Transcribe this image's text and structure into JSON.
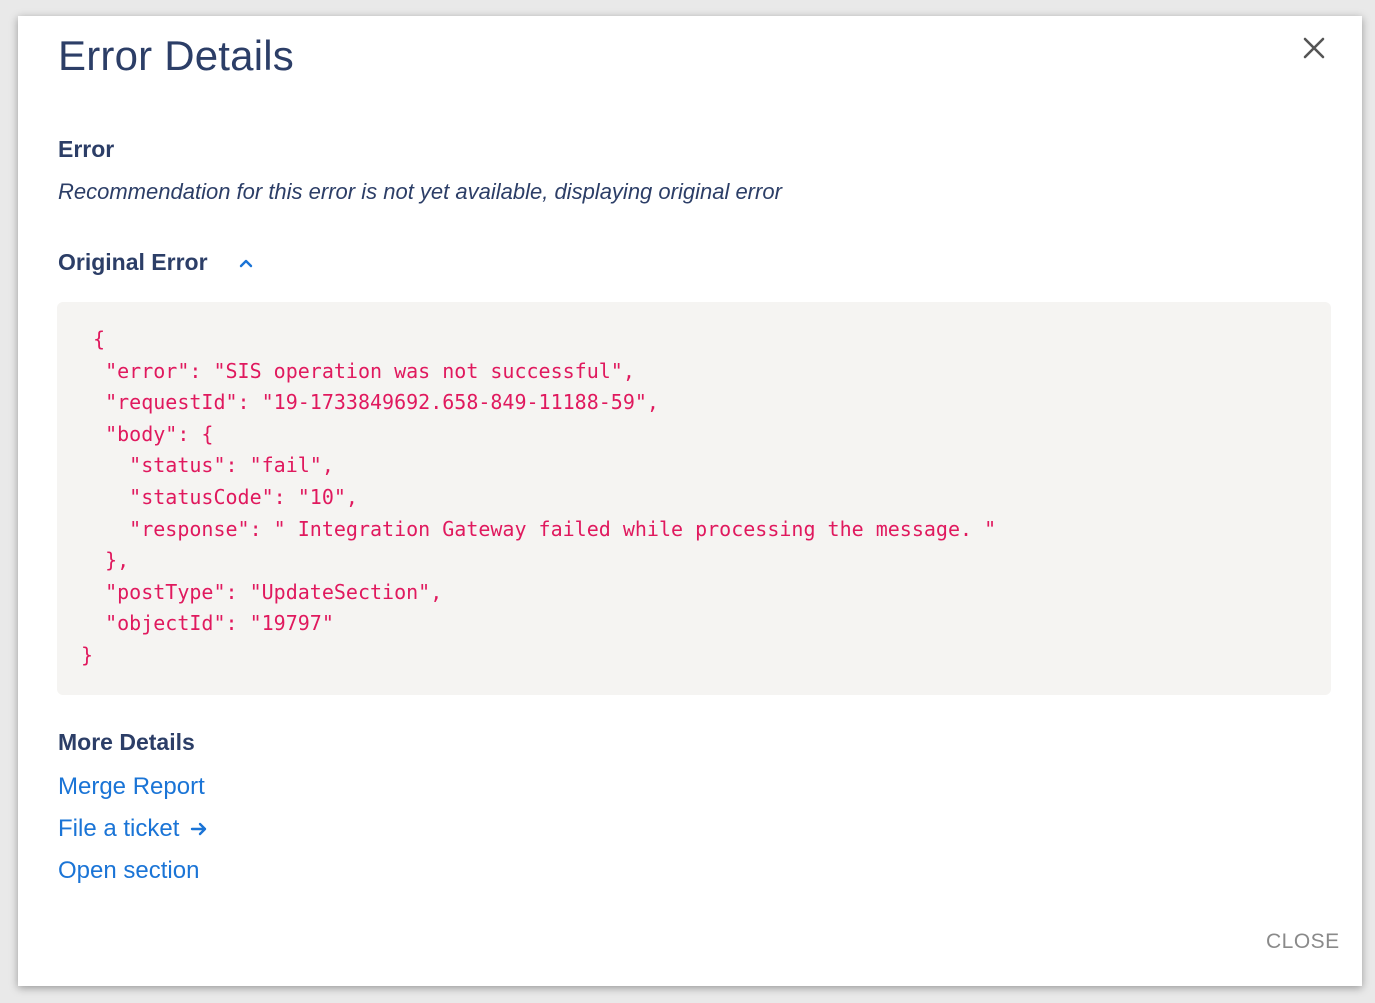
{
  "dialog": {
    "title": "Error Details",
    "close_icon": "close-icon"
  },
  "error_section": {
    "label": "Error",
    "recommendation": "Recommendation for this error is not yet available, displaying original error"
  },
  "original_error": {
    "label": "Original Error",
    "toggle_icon": "chevron-up-icon",
    "code_lines": [
      " {",
      "  \"error\": \"SIS operation was not successful\",",
      "  \"requestId\": \"19-1733849692.658-849-11188-59\",",
      "  \"body\": {",
      "    \"status\": \"fail\",",
      "    \"statusCode\": \"10\",",
      "    \"response\": \" Integration Gateway failed while processing the message. \"",
      "  },",
      "  \"postType\": \"UpdateSection\",",
      "  \"objectId\": \"19797\"",
      "}"
    ]
  },
  "more_details": {
    "label": "More Details",
    "links": {
      "merge_report": "Merge Report",
      "file_ticket": "File a ticket",
      "open_section": "Open section"
    },
    "arrow_icon": "arrow-right-icon"
  },
  "footer": {
    "close_label": "CLOSE"
  },
  "colors": {
    "heading": "#2c3e67",
    "link": "#1a74d6",
    "code": "#e0195e",
    "code_bg": "#f5f4f2",
    "muted": "#8a8a8a"
  }
}
